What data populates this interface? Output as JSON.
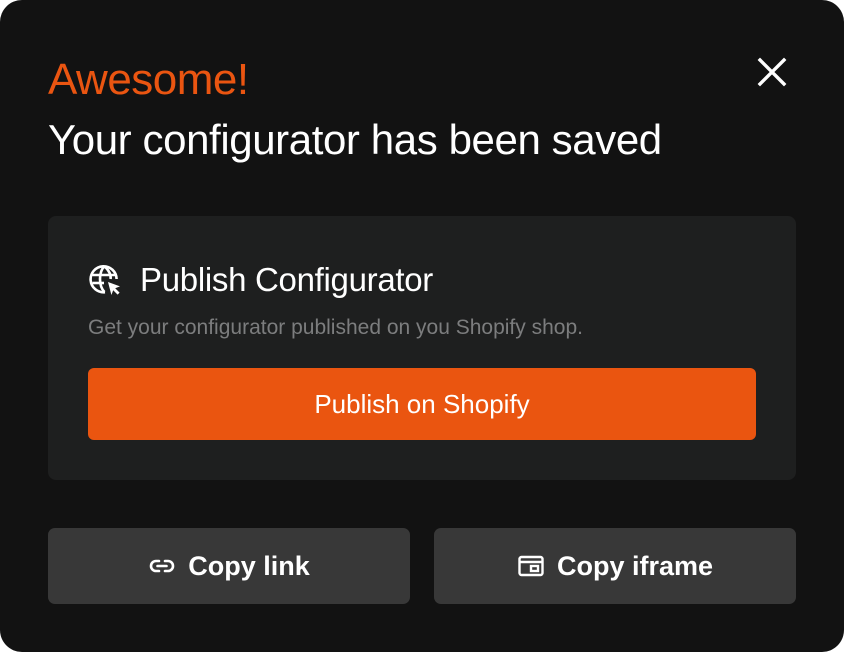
{
  "modal": {
    "headline": "Awesome!",
    "title": "Your configurator has been saved",
    "close_icon": "close-icon"
  },
  "publish_card": {
    "icon": "globe-cursor-icon",
    "title": "Publish Configurator",
    "description": "Get your configurator published on you Shopify shop.",
    "button_label": "Publish on Shopify"
  },
  "actions": {
    "copy_link_label": "Copy link",
    "copy_link_icon": "link-icon",
    "copy_iframe_label": "Copy iframe",
    "copy_iframe_icon": "iframe-icon"
  },
  "colors": {
    "accent": "#ea5510",
    "background": "#121212",
    "card": "#1e1f1f",
    "secondary_button": "#383838",
    "muted_text": "#7c7d7e"
  }
}
